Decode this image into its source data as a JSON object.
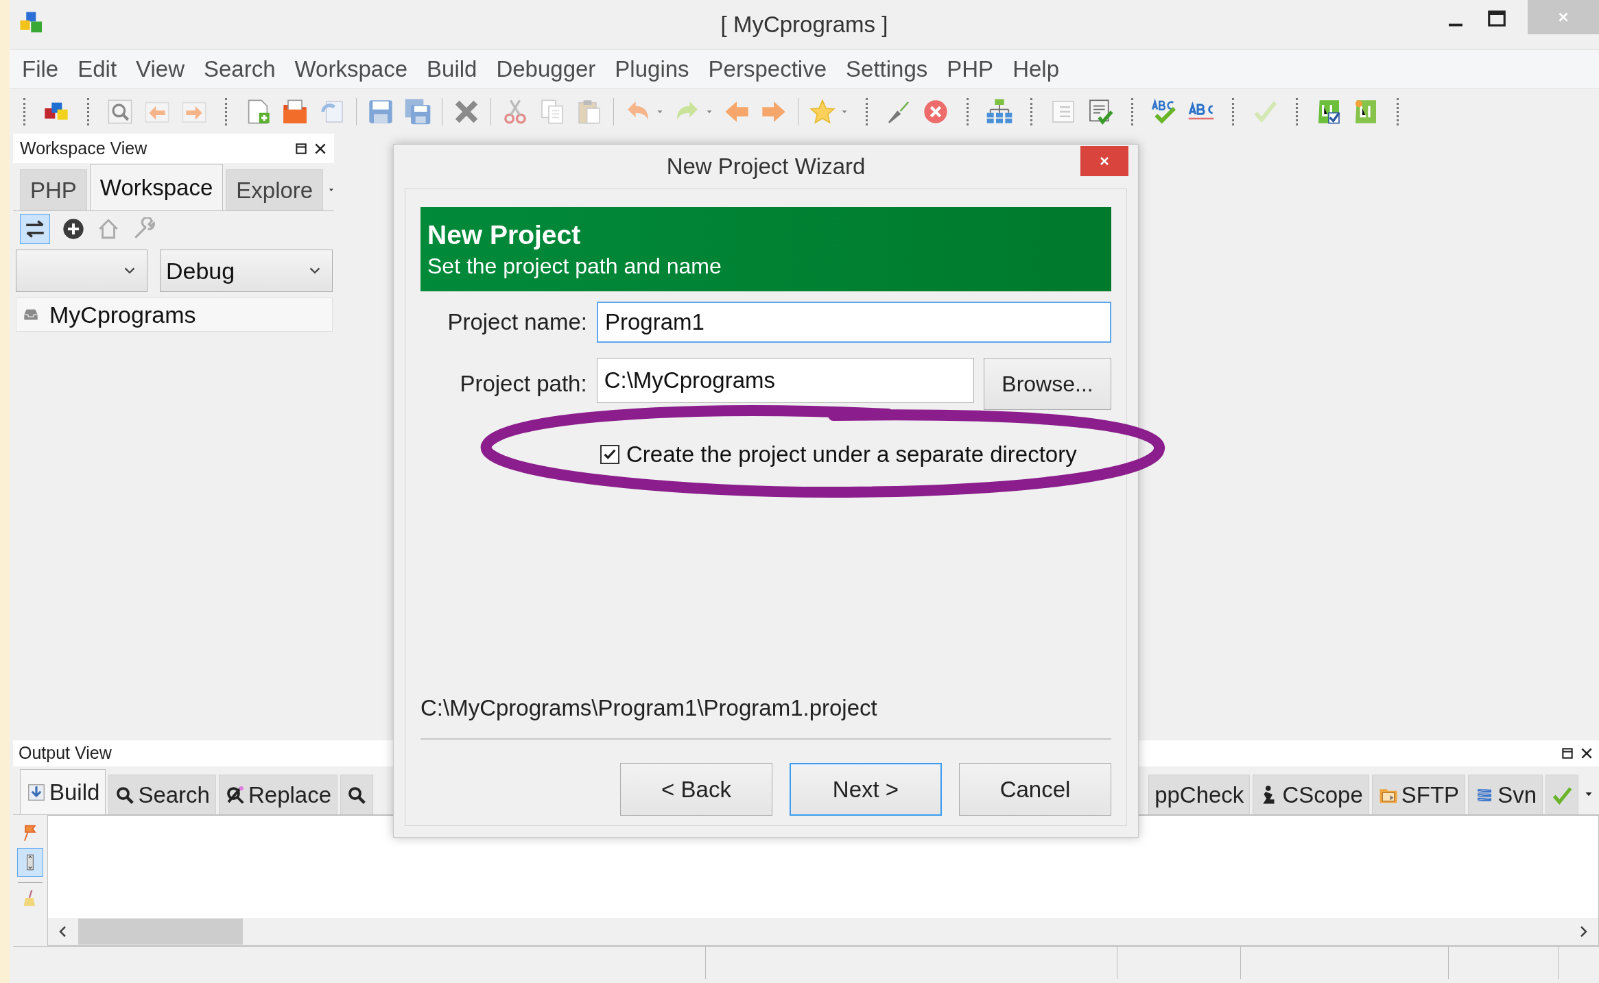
{
  "window": {
    "title": "[ MyCprograms ]"
  },
  "menu": [
    "File",
    "Edit",
    "View",
    "Search",
    "Workspace",
    "Build",
    "Debugger",
    "Plugins",
    "Perspective",
    "Settings",
    "PHP",
    "Help"
  ],
  "workspace_view": {
    "title": "Workspace View",
    "tabs": [
      {
        "label": "PHP",
        "selected": false
      },
      {
        "label": "Workspace",
        "selected": true
      },
      {
        "label": "Explore",
        "selected": false
      }
    ],
    "link_toggle": {
      "on": true
    },
    "config_selector": {
      "value": "Debug"
    },
    "tree": [
      {
        "label": "MyCprograms"
      }
    ]
  },
  "dialog": {
    "title": "New Project Wizard",
    "banner": {
      "title": "New Project",
      "subtitle": "Set the project path and name"
    },
    "fields": [
      {
        "label": "Project name:",
        "value": "Program1",
        "focused": true
      },
      {
        "label": "Project path:",
        "value": "C:\\MyCprograms",
        "focused": false
      }
    ],
    "browse_button": "Browse...",
    "checkbox": {
      "label": "Create the project under a separate directory",
      "checked": true
    },
    "result_path": "C:\\MyCprograms\\Program1\\Program1.project",
    "buttons": [
      {
        "label": "< Back",
        "default": false
      },
      {
        "label": "Next >",
        "default": true
      },
      {
        "label": "Cancel",
        "default": false
      }
    ]
  },
  "output_view": {
    "title": "Output View",
    "tabs": [
      {
        "label": "Build",
        "selected": true
      },
      {
        "label": "Search",
        "selected": false
      },
      {
        "label": "Replace",
        "selected": false
      },
      {
        "selected": false
      },
      {
        "label": "ppCheck",
        "selected": false
      },
      {
        "label": "CScope",
        "selected": false
      },
      {
        "label": "SFTP",
        "selected": false
      },
      {
        "label": "Svn",
        "selected": false
      },
      {
        "selected": false
      }
    ]
  }
}
